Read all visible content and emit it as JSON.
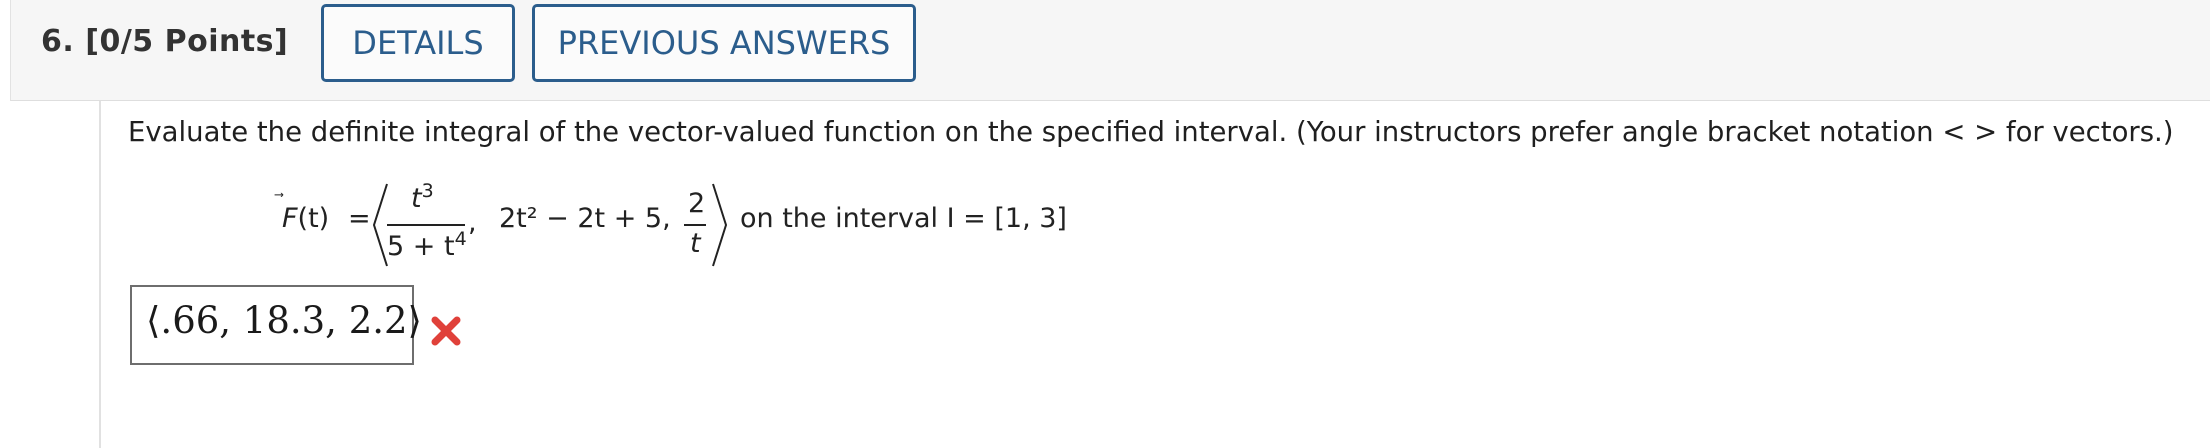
{
  "question": {
    "number": "6.",
    "points": "[0/5 Points]"
  },
  "buttons": {
    "details": "DETAILS",
    "previous_answers": "PREVIOUS ANSWERS"
  },
  "prompt": "Evaluate the definite integral of the vector-valued function on the specified interval. (Your instructors prefer angle bracket notation < > for vectors.)",
  "formula": {
    "lhs_symbol": "F",
    "lhs_arg": "(t)",
    "equals": "=",
    "frac1_num_base": "t",
    "frac1_num_exp": "3",
    "frac1_den_base": "5 + t",
    "frac1_den_exp": "4",
    "term2": "2t² − 2t + 5,",
    "frac3_num": "2",
    "frac3_den": "t",
    "interval_text": "on the interval I = [1, 3]"
  },
  "answer": {
    "value": "⟨.66, 18.3, 2.2⟩",
    "status": "incorrect",
    "status_color": "#e0413a"
  },
  "colors": {
    "accent": "#2b5d8c",
    "header_bg": "#f6f6f6"
  }
}
